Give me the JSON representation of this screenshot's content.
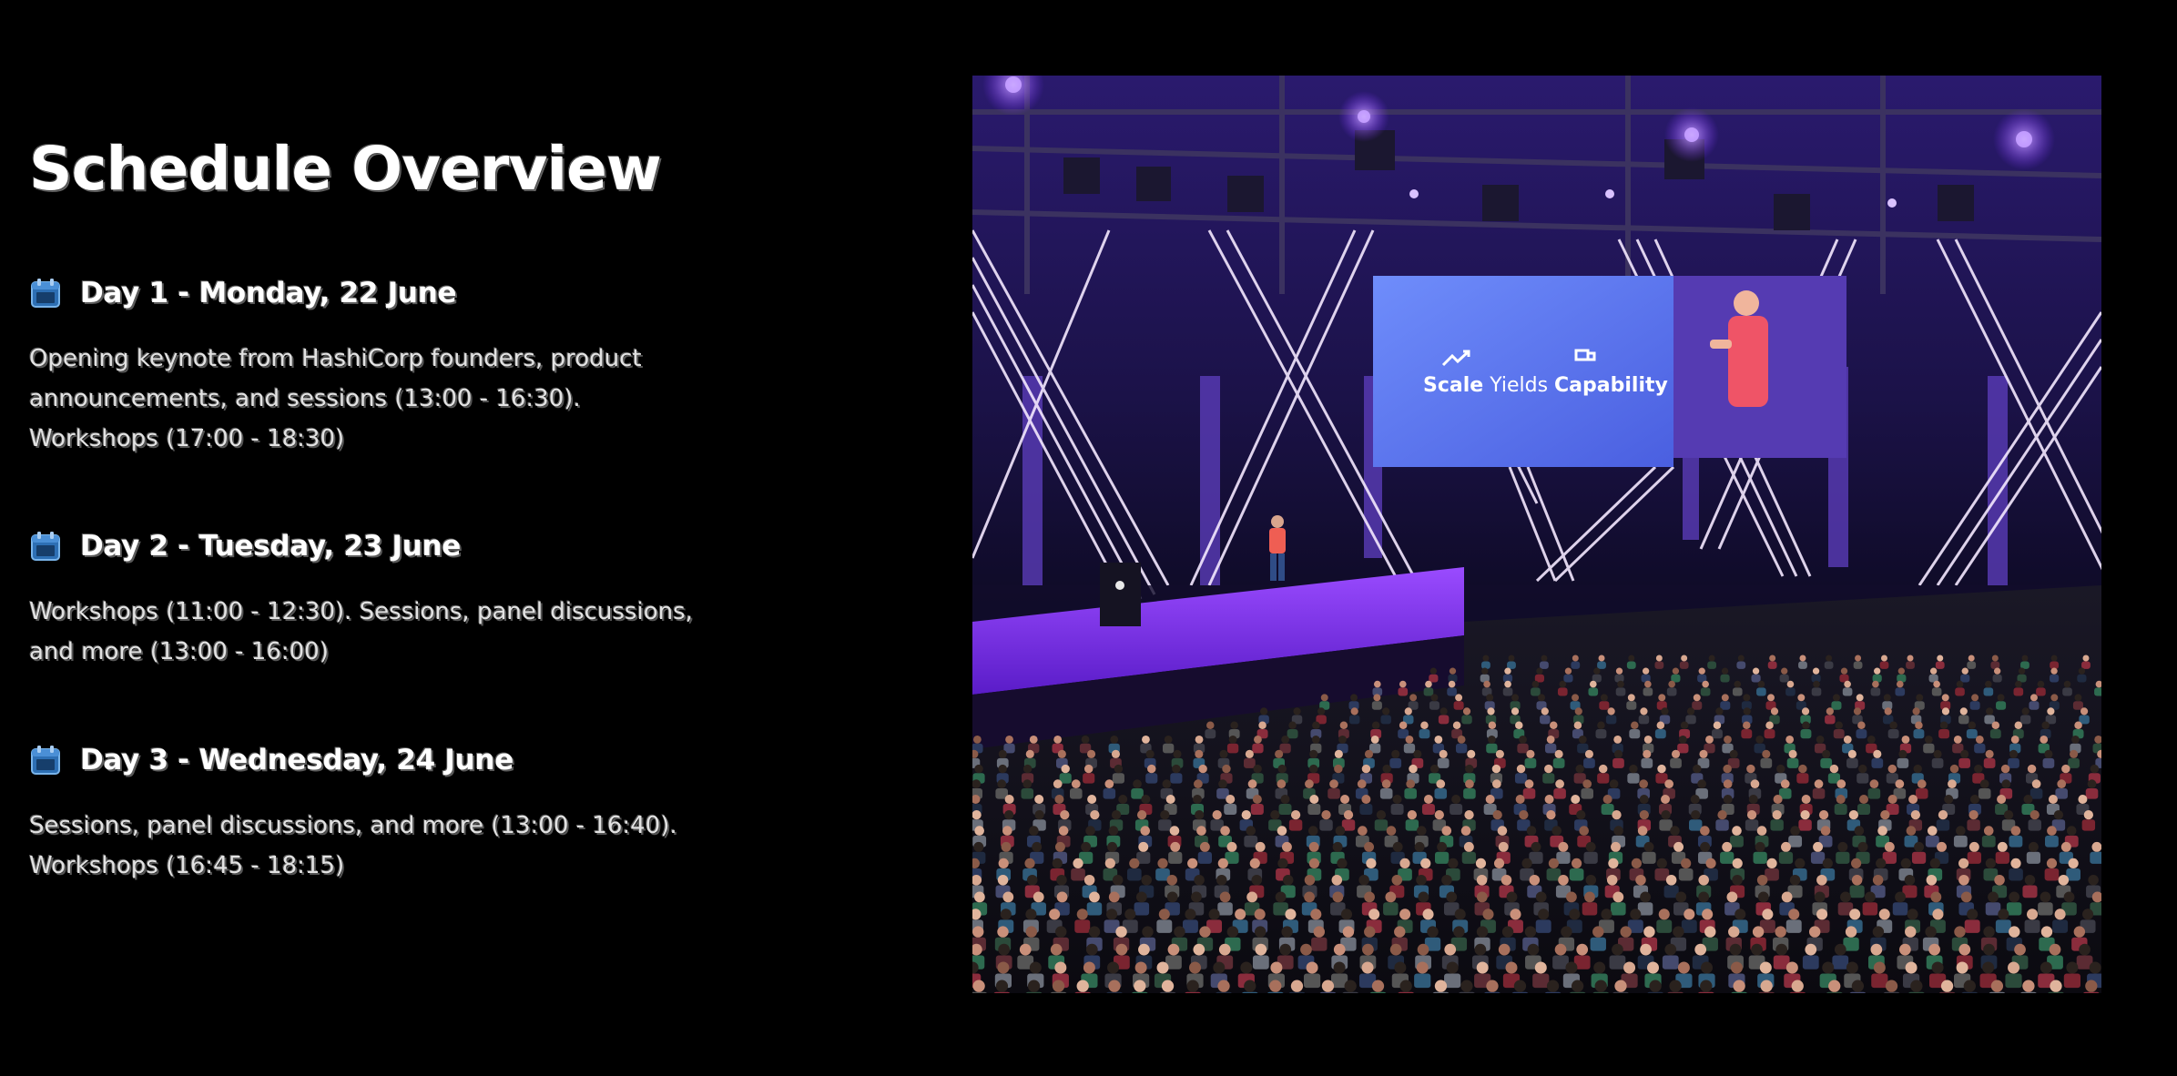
{
  "header": {
    "title": "Schedule Overview"
  },
  "days": [
    {
      "title": "Day 1 - Monday, 22 June",
      "description": "Opening keynote from HashiCorp founders, product announcements, and sessions (13:00 - 16:30). Workshops (17:00 - 18:30)"
    },
    {
      "title": "Day 2 - Tuesday, 23 June",
      "description": "Workshops (11:00 - 12:30). Sessions, panel discussions, and more (13:00 - 16:00)"
    },
    {
      "title": "Day 3 - Wednesday, 24 June",
      "description": "Sessions, panel discussions, and more (13:00 - 16:40). Workshops (16:45 - 18:15)"
    }
  ],
  "photo": {
    "slide_bold_1": "Scale",
    "slide_regular": " Yields ",
    "slide_bold_2": "Capability"
  },
  "colors": {
    "background": "#000000",
    "icon_accent": "#3b82c4",
    "stage_purple": "#7a2cff",
    "slide_blue": "#5a7bf0"
  },
  "icons": {
    "day_icon": "calendar-icon"
  }
}
